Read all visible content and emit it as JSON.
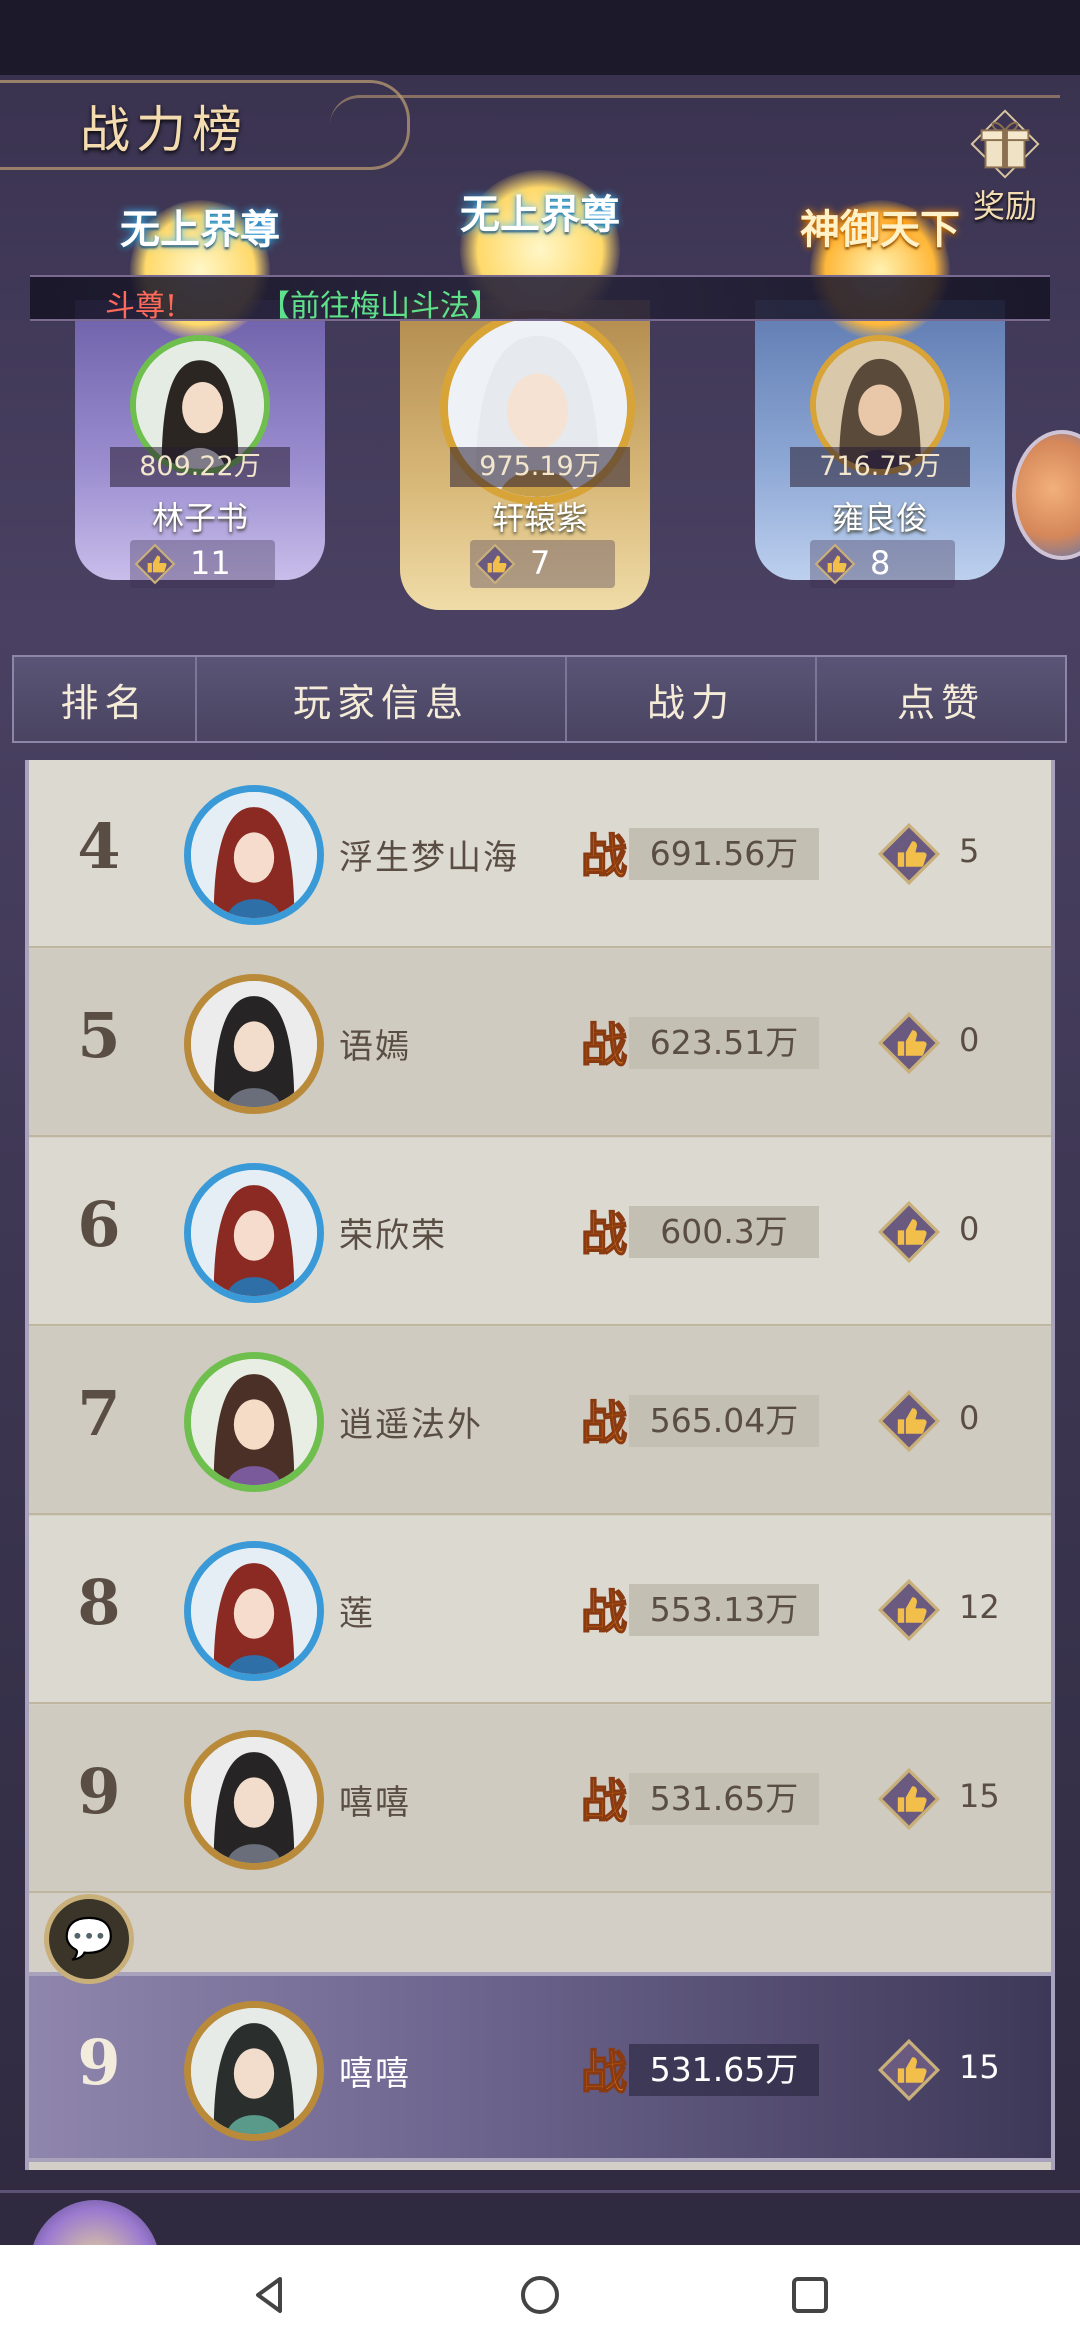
{
  "page": {
    "title": "战力榜",
    "reward_label": "奖励"
  },
  "ticker": {
    "prefix": "斗尊!",
    "link": "【前往梅山斗法】"
  },
  "top3": [
    {
      "rank": 2,
      "title_badge": "无上界尊",
      "power": "809.22万",
      "name": "林子书",
      "likes": "11"
    },
    {
      "rank": 1,
      "title_badge": "无上界尊",
      "power": "975.19万",
      "name": "轩辕紫",
      "likes": "7"
    },
    {
      "rank": 3,
      "title_badge": "神御天下",
      "power": "716.75万",
      "name": "雍良俊",
      "likes": "8"
    }
  ],
  "table": {
    "headers": [
      "排名",
      "玩家信息",
      "战力",
      "点赞"
    ],
    "rows": [
      {
        "rank": "4",
        "name": "浮生梦山海",
        "power": "691.56万",
        "likes": "5",
        "frame": "blue"
      },
      {
        "rank": "5",
        "name": "语嫣",
        "power": "623.51万",
        "likes": "0",
        "frame": "gold"
      },
      {
        "rank": "6",
        "name": "荣欣荣",
        "power": "600.3万",
        "likes": "0",
        "frame": "blue"
      },
      {
        "rank": "7",
        "name": "逍遥法外",
        "power": "565.04万",
        "likes": "0",
        "frame": "green"
      },
      {
        "rank": "8",
        "name": "莲",
        "power": "553.13万",
        "likes": "12",
        "frame": "blue"
      },
      {
        "rank": "9",
        "name": "嘻嘻",
        "power": "531.65万",
        "likes": "15",
        "frame": "gold"
      }
    ]
  },
  "my_row": {
    "rank": "9",
    "name": "嘻嘻",
    "power": "531.65万",
    "likes": "15"
  },
  "icons": {
    "power": "zhan-battle-icon",
    "like": "thumbs-up-icon",
    "chat": "chat-bubble-icon",
    "reward": "gift-icon"
  },
  "colors": {
    "accent_gold": "#d8a438",
    "ticker_red": "#ff6a5a",
    "ticker_green": "#5fe08a",
    "power_orange": "#f08a1e"
  }
}
